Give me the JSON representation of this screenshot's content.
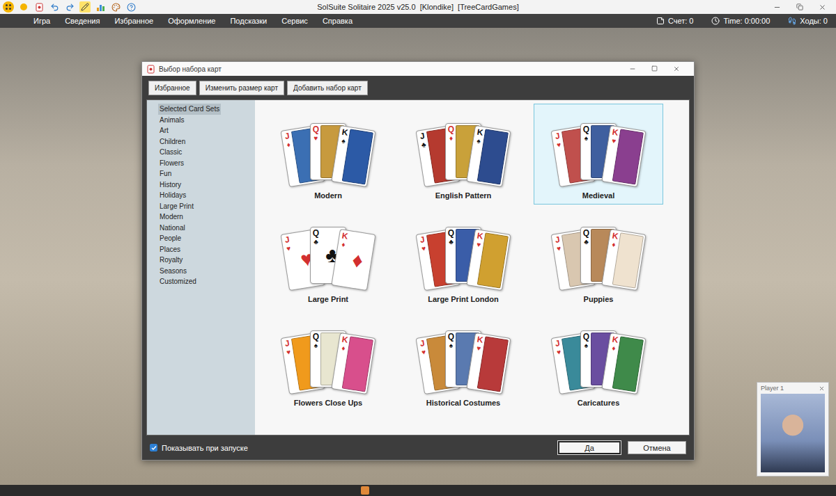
{
  "window": {
    "title": "SolSuite Solitaire 2025 v25.0  [Klondike]  [TreeCardGames]"
  },
  "quick_toolbar": {
    "pencil_active": true
  },
  "menu": [
    "Игра",
    "Сведения",
    "Избранное",
    "Оформление",
    "Подсказки",
    "Сервис",
    "Справка"
  ],
  "status": [
    {
      "kind": "score",
      "label": "Счет: 0"
    },
    {
      "kind": "time",
      "label": "Time: 0:00:00"
    },
    {
      "kind": "moves",
      "label": "Ходы: 0"
    }
  ],
  "dialog": {
    "title": "Выбор набора карт",
    "toolbar": [
      "Избранное",
      "Изменить размер карт",
      "Добавить набор карт"
    ],
    "categories": [
      {
        "label": "Selected Card Sets",
        "selected": true
      },
      {
        "label": "Animals",
        "selected": false
      },
      {
        "label": "Art",
        "selected": false
      },
      {
        "label": "Children",
        "selected": false
      },
      {
        "label": "Classic",
        "selected": false
      },
      {
        "label": "Flowers",
        "selected": false
      },
      {
        "label": "Fun",
        "selected": false
      },
      {
        "label": "History",
        "selected": false
      },
      {
        "label": "Holidays",
        "selected": false
      },
      {
        "label": "Large Print",
        "selected": false
      },
      {
        "label": "Modern",
        "selected": false
      },
      {
        "label": "National",
        "selected": false
      },
      {
        "label": "People",
        "selected": false
      },
      {
        "label": "Places",
        "selected": false
      },
      {
        "label": "Royalty",
        "selected": false
      },
      {
        "label": "Seasons",
        "selected": false
      },
      {
        "label": "Customized",
        "selected": false
      }
    ],
    "card_sets": [
      {
        "name": "Modern",
        "selected": false,
        "kind": "figure",
        "cards": [
          {
            "rank": "J",
            "suit": "♦",
            "color": "#d32f2f"
          },
          {
            "rank": "Q",
            "suit": "♥",
            "color": "#d32f2f"
          },
          {
            "rank": "K",
            "suit": "♠",
            "color": "#111111"
          }
        ]
      },
      {
        "name": "English Pattern",
        "selected": false,
        "kind": "figure",
        "cards": [
          {
            "rank": "J",
            "suit": "♣",
            "color": "#111111"
          },
          {
            "rank": "Q",
            "suit": "♦",
            "color": "#d32f2f"
          },
          {
            "rank": "K",
            "suit": "♠",
            "color": "#111111"
          }
        ]
      },
      {
        "name": "Medieval",
        "selected": true,
        "kind": "figure",
        "cards": [
          {
            "rank": "J",
            "suit": "♥",
            "color": "#d32f2f"
          },
          {
            "rank": "Q",
            "suit": "♠",
            "color": "#111111"
          },
          {
            "rank": "K",
            "suit": "♥",
            "color": "#d32f2f"
          }
        ]
      },
      {
        "name": "Large Print",
        "selected": false,
        "kind": "pip",
        "cards": [
          {
            "rank": "J",
            "suit": "♥",
            "color": "#d32f2f"
          },
          {
            "rank": "Q",
            "suit": "♣",
            "color": "#111111"
          },
          {
            "rank": "K",
            "suit": "♦",
            "color": "#d32f2f"
          }
        ]
      },
      {
        "name": "Large Print London",
        "selected": false,
        "kind": "figure",
        "cards": [
          {
            "rank": "J",
            "suit": "♥",
            "color": "#d32f2f"
          },
          {
            "rank": "Q",
            "suit": "♣",
            "color": "#111111"
          },
          {
            "rank": "K",
            "suit": "♥",
            "color": "#d32f2f"
          }
        ]
      },
      {
        "name": "Puppies",
        "selected": false,
        "kind": "figure",
        "cards": [
          {
            "rank": "J",
            "suit": "♥",
            "color": "#d32f2f"
          },
          {
            "rank": "Q",
            "suit": "♣",
            "color": "#111111"
          },
          {
            "rank": "K",
            "suit": "♦",
            "color": "#d32f2f"
          }
        ]
      },
      {
        "name": "Flowers Close Ups",
        "selected": false,
        "kind": "figure",
        "cards": [
          {
            "rank": "J",
            "suit": "♥",
            "color": "#d32f2f"
          },
          {
            "rank": "Q",
            "suit": "♠",
            "color": "#111111"
          },
          {
            "rank": "K",
            "suit": "♦",
            "color": "#d32f2f"
          }
        ]
      },
      {
        "name": "Historical Costumes",
        "selected": false,
        "kind": "figure",
        "cards": [
          {
            "rank": "J",
            "suit": "♥",
            "color": "#d32f2f"
          },
          {
            "rank": "Q",
            "suit": "♠",
            "color": "#111111"
          },
          {
            "rank": "K",
            "suit": "♥",
            "color": "#d32f2f"
          }
        ]
      },
      {
        "name": "Caricatures",
        "selected": false,
        "kind": "figure",
        "cards": [
          {
            "rank": "J",
            "suit": "♥",
            "color": "#d32f2f"
          },
          {
            "rank": "Q",
            "suit": "♠",
            "color": "#111111"
          },
          {
            "rank": "K",
            "suit": "♦",
            "color": "#d32f2f"
          }
        ]
      }
    ],
    "show_on_startup": {
      "label": "Показывать при запуске",
      "checked": true
    },
    "buttons": [
      {
        "label": "Да",
        "default": true
      },
      {
        "label": "Отмена",
        "default": false
      }
    ]
  },
  "player": {
    "name": "Player 1"
  }
}
